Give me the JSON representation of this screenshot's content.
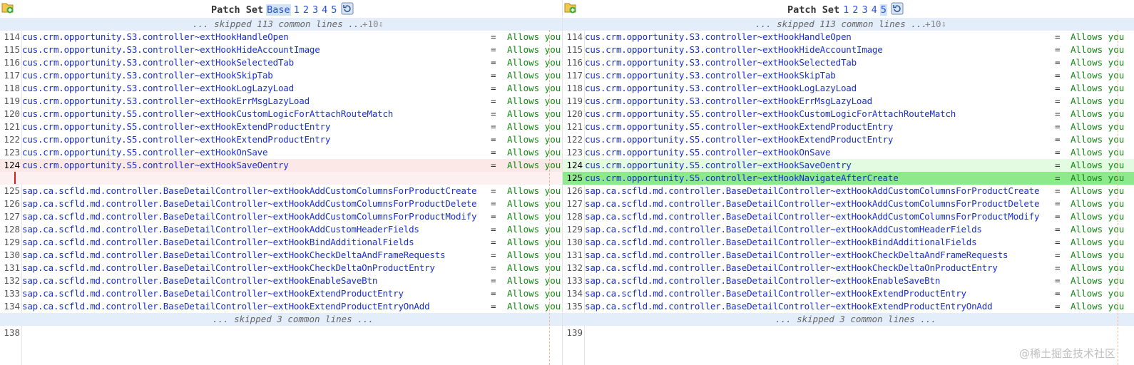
{
  "header": {
    "left": {
      "label": "Patch Set",
      "sets": [
        "Base",
        "1",
        "2",
        "3",
        "4",
        "5"
      ],
      "selected": "Base"
    },
    "right": {
      "label": "Patch Set",
      "sets": [
        "1",
        "2",
        "3",
        "4",
        "5"
      ],
      "selected": "5"
    }
  },
  "skip_top": {
    "text": "... skipped 113 common lines ...",
    "expand": "+10⇩"
  },
  "skip_mid": {
    "text": "... skipped 3 common lines ..."
  },
  "value_text": "Allows you",
  "equals": "=",
  "left_rows": [
    {
      "n": "114",
      "code": "cus.crm.opportunity.S3.controller~extHookHandleOpen"
    },
    {
      "n": "115",
      "code": "cus.crm.opportunity.S3.controller~extHookHideAccountImage"
    },
    {
      "n": "116",
      "code": "cus.crm.opportunity.S3.controller~extHookSelectedTab"
    },
    {
      "n": "117",
      "code": "cus.crm.opportunity.S3.controller~extHookSkipTab"
    },
    {
      "n": "118",
      "code": "cus.crm.opportunity.S3.controller~extHookLogLazyLoad"
    },
    {
      "n": "119",
      "code": "cus.crm.opportunity.S3.controller~extHookErrMsgLazyLoad"
    },
    {
      "n": "120",
      "code": "cus.crm.opportunity.S5.controller~extHookCustomLogicForAttachRouteMatch"
    },
    {
      "n": "121",
      "code": "cus.crm.opportunity.S5.controller~extHookExtendProductEntry"
    },
    {
      "n": "122",
      "code": "cus.crm.opportunity.S5.controller~extHookExtendProductEntry"
    },
    {
      "n": "123",
      "code": "cus.crm.opportunity.S5.controller~extHookOnSave"
    },
    {
      "n": "124",
      "code": "cus.crm.opportunity.S5.controller~extHookSaveOentry",
      "state": "deleted"
    },
    {
      "n": "",
      "code": "",
      "state": "blank",
      "noval": true
    },
    {
      "n": "125",
      "code": "sap.ca.scfld.md.controller.BaseDetailController~extHookAddCustomColumnsForProductCreate"
    },
    {
      "n": "126",
      "code": "sap.ca.scfld.md.controller.BaseDetailController~extHookAddCustomColumnsForProductDelete"
    },
    {
      "n": "127",
      "code": "sap.ca.scfld.md.controller.BaseDetailController~extHookAddCustomColumnsForProductModify"
    },
    {
      "n": "128",
      "code": "sap.ca.scfld.md.controller.BaseDetailController~extHookAddCustomHeaderFields"
    },
    {
      "n": "129",
      "code": "sap.ca.scfld.md.controller.BaseDetailController~extHookBindAdditionalFields"
    },
    {
      "n": "130",
      "code": "sap.ca.scfld.md.controller.BaseDetailController~extHookCheckDeltaAndFrameRequests"
    },
    {
      "n": "131",
      "code": "sap.ca.scfld.md.controller.BaseDetailController~extHookCheckDeltaOnProductEntry"
    },
    {
      "n": "132",
      "code": "sap.ca.scfld.md.controller.BaseDetailController~extHookEnableSaveBtn"
    },
    {
      "n": "133",
      "code": "sap.ca.scfld.md.controller.BaseDetailController~extHookExtendProductEntry"
    },
    {
      "n": "134",
      "code": "sap.ca.scfld.md.controller.BaseDetailController~extHookExtendProductEntryOnAdd"
    }
  ],
  "right_rows": [
    {
      "n": "114",
      "code": "cus.crm.opportunity.S3.controller~extHookHandleOpen"
    },
    {
      "n": "115",
      "code": "cus.crm.opportunity.S3.controller~extHookHideAccountImage"
    },
    {
      "n": "116",
      "code": "cus.crm.opportunity.S3.controller~extHookSelectedTab"
    },
    {
      "n": "117",
      "code": "cus.crm.opportunity.S3.controller~extHookSkipTab"
    },
    {
      "n": "118",
      "code": "cus.crm.opportunity.S3.controller~extHookLogLazyLoad"
    },
    {
      "n": "119",
      "code": "cus.crm.opportunity.S3.controller~extHookErrMsgLazyLoad"
    },
    {
      "n": "120",
      "code": "cus.crm.opportunity.S5.controller~extHookCustomLogicForAttachRouteMatch"
    },
    {
      "n": "121",
      "code": "cus.crm.opportunity.S5.controller~extHookExtendProductEntry"
    },
    {
      "n": "122",
      "code": "cus.crm.opportunity.S5.controller~extHookExtendProductEntry"
    },
    {
      "n": "123",
      "code": "cus.crm.opportunity.S5.controller~extHookOnSave"
    },
    {
      "n": "124",
      "code": "cus.crm.opportunity.S5.controller~extHookSaveOentry",
      "state": "changed"
    },
    {
      "n": "125",
      "code": "cus.crm.opportunity.S5.controller~extHookNavigateAfterCreate",
      "state": "inserted"
    },
    {
      "n": "126",
      "code": "sap.ca.scfld.md.controller.BaseDetailController~extHookAddCustomColumnsForProductCreate"
    },
    {
      "n": "127",
      "code": "sap.ca.scfld.md.controller.BaseDetailController~extHookAddCustomColumnsForProductDelete"
    },
    {
      "n": "128",
      "code": "sap.ca.scfld.md.controller.BaseDetailController~extHookAddCustomColumnsForProductModify"
    },
    {
      "n": "129",
      "code": "sap.ca.scfld.md.controller.BaseDetailController~extHookAddCustomHeaderFields"
    },
    {
      "n": "130",
      "code": "sap.ca.scfld.md.controller.BaseDetailController~extHookBindAdditionalFields"
    },
    {
      "n": "131",
      "code": "sap.ca.scfld.md.controller.BaseDetailController~extHookCheckDeltaAndFrameRequests"
    },
    {
      "n": "132",
      "code": "sap.ca.scfld.md.controller.BaseDetailController~extHookCheckDeltaOnProductEntry"
    },
    {
      "n": "133",
      "code": "sap.ca.scfld.md.controller.BaseDetailController~extHookEnableSaveBtn"
    },
    {
      "n": "134",
      "code": "sap.ca.scfld.md.controller.BaseDetailController~extHookExtendProductEntry"
    },
    {
      "n": "135",
      "code": "sap.ca.scfld.md.controller.BaseDetailController~extHookExtendProductEntryOnAdd"
    }
  ],
  "left_after": [
    {
      "n": "138"
    }
  ],
  "right_after": [
    {
      "n": "139"
    }
  ],
  "watermark": "@稀土掘金技术社区",
  "icons": {
    "add": "add-file-icon",
    "refresh": "refresh-icon"
  },
  "colors": {
    "deleted": "#fde8e8",
    "changed": "#e3fbe1",
    "inserted": "#8ee88c",
    "skip": "#e4eefa"
  }
}
